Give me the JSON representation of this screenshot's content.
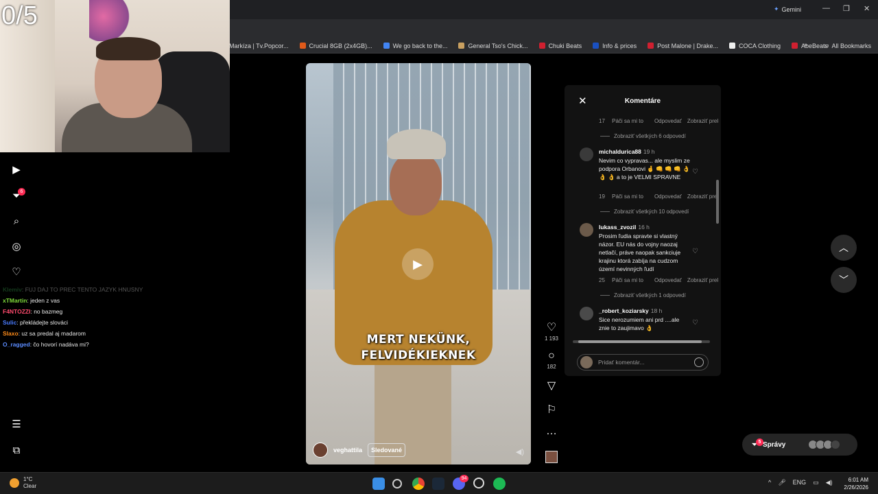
{
  "browser": {
    "gemini_label": "Gemini",
    "bookmarks": [
      {
        "label": "Markíza | Tv.Popcor...",
        "color": "#2a6cc9"
      },
      {
        "label": "Crucial 8GB (2x4GB)...",
        "color": "#e05a1a"
      },
      {
        "label": "We go back to the...",
        "color": "#4285f4"
      },
      {
        "label": "General Tso's Chick...",
        "color": "#c9a060"
      },
      {
        "label": "Chuki Beats",
        "color": "#d02030"
      },
      {
        "label": "Info & prices",
        "color": "#1a50c0"
      },
      {
        "label": "Post Malone | Drake...",
        "color": "#d02030"
      },
      {
        "label": "COCA Clothing",
        "color": "#222222"
      },
      {
        "label": "AbeBeats",
        "color": "#d02030"
      }
    ],
    "all_bookmarks": "All Bookmarks"
  },
  "webcam": {
    "counter": "0/5"
  },
  "sidebar": {
    "notification_count": "6"
  },
  "chat": [
    {
      "user": "Klemiv",
      "color": "#3aa050",
      "text": ": FUJ DAJ TO PREC TENTO JAZYK HNUSNY"
    },
    {
      "user": "xTMartin",
      "color": "#7fdc3a",
      "text": ": jeden z vas"
    },
    {
      "user": "F4NTOZZI",
      "color": "#ff4b6e",
      "text": ": no bazmeg"
    },
    {
      "user": "Sulic",
      "color": "#4a7cff",
      "text": ": překládejte slováci"
    },
    {
      "user": "Slaxo",
      "color": "#ff8c1a",
      "text": ": uz sa predal aj madarom"
    },
    {
      "user": "O_ragged",
      "color": "#5b8cff",
      "text": ": čo hovorí nadáva mi?"
    }
  ],
  "video": {
    "caption_line1": "MERT NEKÜNK,",
    "caption_line2": "FELVIDÉKIEKNEK",
    "author": "veghattila",
    "follow_label": "Sledované",
    "likes": "1 193",
    "comments": "182"
  },
  "comments_panel": {
    "title": "Komentáre",
    "like_label": "Páči sa mi to",
    "reply_label": "Odpovedať",
    "translate_label": "Zobraziť prekla",
    "top_meta": {
      "likes": "17"
    },
    "view_more_1": "Zobraziť všetkých 6 odpovedí",
    "items": [
      {
        "user": "michaldurica88",
        "time": "19 h",
        "text": "Nevim co vypravas... ale myslim ze podpora Orbanovi 🤞 👊 👊 👊 👌 👌 👌 a to je VELMI SPRAVNE",
        "likes": "19",
        "view_more": "Zobraziť všetkých 10 odpovedí"
      },
      {
        "user": "lukass_zvozil",
        "time": "16 h",
        "text": "Prosim ľudia spravte si vlastný názor. EU nás do vojny naozaj netlačí, práve naopak sankciuje krajinu ktorá zabíja na cudzom území nevinných ľudí",
        "likes": "25",
        "view_more": "Zobraziť všetkých 1 odpovedí"
      },
      {
        "user": "_robert_koziarsky",
        "time": "18 h",
        "text": "Sice nerozumiem ani prd ....ale znie to zaujimavo 👌"
      }
    ],
    "input_placeholder": "Pridať komentár..."
  },
  "messages": {
    "label": "Správy",
    "badge": "5"
  },
  "taskbar": {
    "temp": "1°C",
    "weather": "Clear",
    "lang": "ENG",
    "time": "6:01 AM",
    "date": "2/26/2026",
    "discord_badge": "94"
  }
}
